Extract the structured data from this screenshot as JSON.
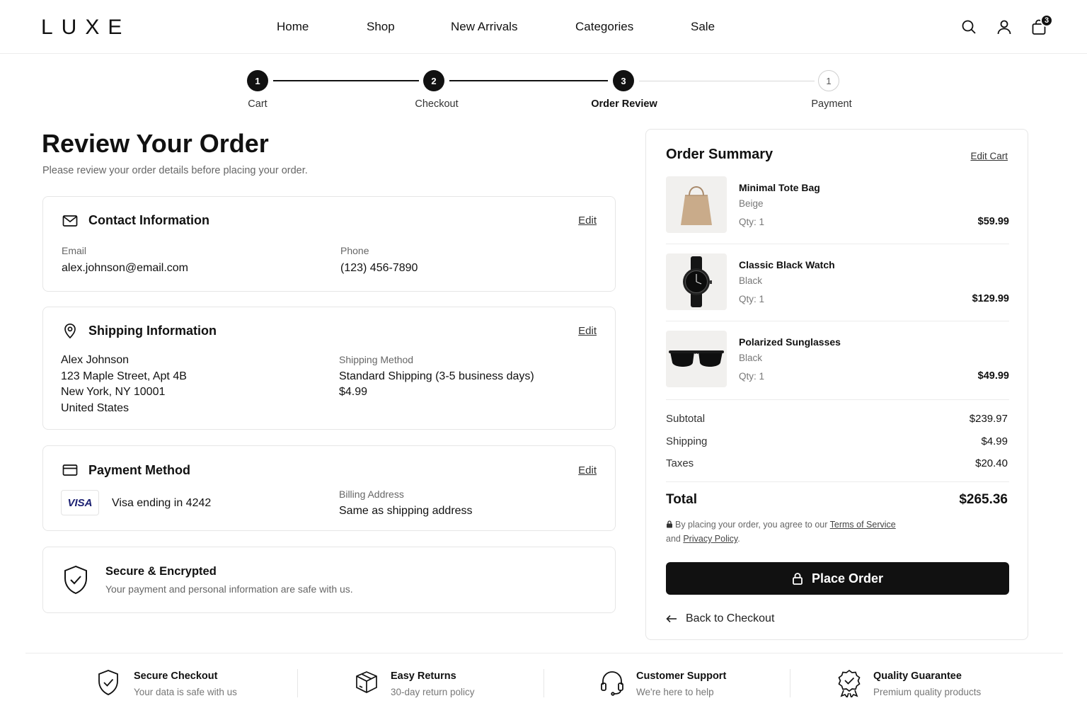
{
  "header": {
    "logo": "LUXE",
    "nav": [
      "Home",
      "Shop",
      "New Arrivals",
      "Categories",
      "Sale"
    ],
    "cart_count": "3",
    "icons": [
      "search-icon",
      "user-icon",
      "bag-icon"
    ]
  },
  "stepper": {
    "steps": [
      {
        "number": "1",
        "label": "Cart",
        "state": "complete"
      },
      {
        "number": "2",
        "label": "Checkout",
        "state": "complete"
      },
      {
        "number": "3",
        "label": "Order Review",
        "state": "active"
      },
      {
        "number": "1",
        "label": "Payment",
        "state": "pending"
      }
    ]
  },
  "page": {
    "title": "Review Your Order",
    "subtitle": "Please review your order details before placing your order."
  },
  "contact": {
    "title": "Contact Information",
    "edit_label": "Edit",
    "email_label": "Email",
    "email_value": "alex.johnson@email.com",
    "phone_label": "Phone",
    "phone_value": "(123) 456-7890"
  },
  "shipping": {
    "title": "Shipping Information",
    "edit_label": "Edit",
    "address": [
      "Alex Johnson",
      "123 Maple Street, Apt 4B",
      "New York, NY 10001",
      "United States"
    ],
    "method_label": "Shipping Method",
    "method_value": "Standard Shipping (3-5 business days)",
    "method_price": "$4.99"
  },
  "payment": {
    "title": "Payment Method",
    "edit_label": "Edit",
    "card_brand": "VISA",
    "card_text": "Visa ending in 4242",
    "billing_label": "Billing Address",
    "billing_value": "Same as shipping address"
  },
  "secure": {
    "title": "Secure & Encrypted",
    "text": "Your payment and personal information are safe with us."
  },
  "summary": {
    "title": "Order Summary",
    "edit_cart_label": "Edit Cart",
    "items": [
      {
        "name": "Minimal Tote Bag",
        "variant": "Beige",
        "qty": "Qty:  1",
        "price": "$59.99",
        "image": "tote-bag-image"
      },
      {
        "name": "Classic Black Watch",
        "variant": "Black",
        "qty": "Qty:  1",
        "price": "$129.99",
        "image": "watch-image"
      },
      {
        "name": "Polarized Sunglasses",
        "variant": "Black",
        "qty": "Qty:  1",
        "price": "$49.99",
        "image": "sunglasses-image"
      }
    ],
    "subtotal_label": "Subtotal",
    "subtotal_value": "$239.97",
    "shipping_label": "Shipping",
    "shipping_value": "$4.99",
    "taxes_label": "Taxes",
    "taxes_value": "$20.40",
    "total_label": "Total",
    "total_value": "$265.36",
    "terms_prefix": "By placing your order, you agree to our ",
    "terms_link": "Terms of Service",
    "terms_and": "and ",
    "privacy_link": "Privacy Policy",
    "terms_suffix": ".",
    "place_order_label": "Place Order",
    "back_label": "Back to Checkout"
  },
  "footer": {
    "features": [
      {
        "title": "Secure Checkout",
        "subtitle": "Your data is safe with us",
        "icon": "shield-check-icon"
      },
      {
        "title": "Easy Returns",
        "subtitle": "30-day return policy",
        "icon": "return-box-icon"
      },
      {
        "title": "Customer Support",
        "subtitle": "We're here to help",
        "icon": "headset-icon"
      },
      {
        "title": "Quality Guarantee",
        "subtitle": "Premium quality products",
        "icon": "award-badge-icon"
      }
    ]
  },
  "colors": {
    "primary": "#111111",
    "muted_text": "#666666",
    "border": "#e6e6e6",
    "visa_blue": "#1a1f71"
  }
}
